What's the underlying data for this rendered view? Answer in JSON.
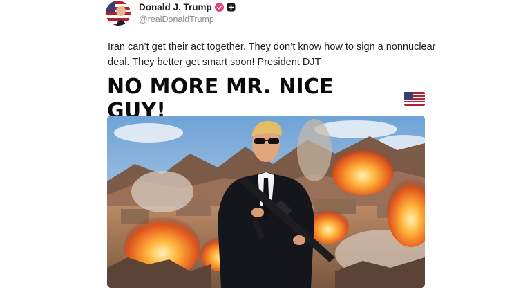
{
  "post": {
    "author": {
      "display_name": "Donald J. Trump",
      "handle": "@realDonaldTrump",
      "avatar_icon": "avatar-flag-portrait",
      "verified_icon": "verified-badge-icon",
      "extra_badge_icon": "plus-badge-icon"
    },
    "text": "Iran can’t get their act together. They don’t know how to sign a nonnuclear deal. They better get smart soon! President DJT",
    "media": {
      "banner_text": "NO MORE MR. NICE GUY!",
      "banner_emoji": "us-flag-icon",
      "image_description_icon": "post-image"
    }
  },
  "colors": {
    "verified": "#e0457a",
    "text": "#1f1f23",
    "muted": "#8a8a92"
  }
}
